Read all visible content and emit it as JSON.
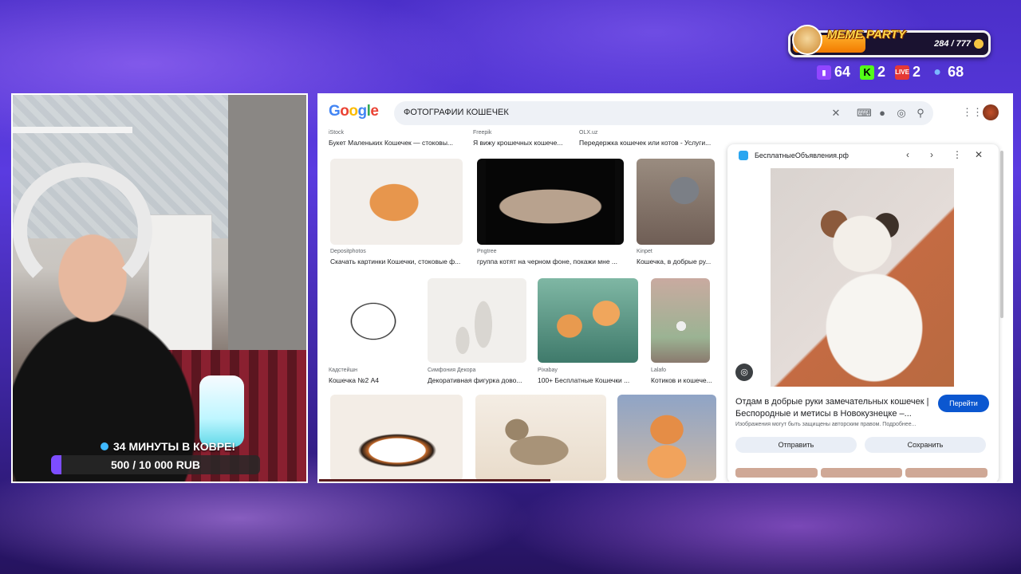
{
  "overlay": {
    "meme_party": {
      "title": "MEME PARTY",
      "count": "284 / 777",
      "progress": 0.3655
    },
    "stats": [
      {
        "icon": "twitch-icon",
        "value": "64"
      },
      {
        "icon": "kick-icon",
        "value": "2"
      },
      {
        "icon": "live-icon",
        "value": "2"
      },
      {
        "icon": "viewers-icon",
        "value": "68"
      }
    ]
  },
  "webcam": {
    "goal_top": "34 МИНУТЫ В КОВРЕ!",
    "goal_text": "500 / 10 000 RUB",
    "goal_progress": 0.05
  },
  "browser": {
    "search_query": "ФОТОГРАФИИ КОШЕЧЕК",
    "top_row": [
      {
        "source": "iStock",
        "caption": "Букет Маленьких Кошечек — стоковы..."
      },
      {
        "source": "Freepik",
        "caption": "Я вижу крошечных кошече..."
      },
      {
        "source": "OLX.uz",
        "caption": "Передержка кошечек или котов - Услуги..."
      }
    ],
    "row1": [
      {
        "source": "Depositphotos",
        "caption": "Скачать картинки Кошечки, стоковые ф..."
      },
      {
        "source": "Pngtree",
        "caption": "группа котят на черном фоне, покажи мне ..."
      },
      {
        "source": "Kinpet",
        "caption": "Кошечка, в добрые ру..."
      }
    ],
    "row2": [
      {
        "source": "Кадстейшн",
        "caption": "Кошечка №2 А4"
      },
      {
        "source": "Симфония Декора",
        "caption": "Декоративная фигурка дово..."
      },
      {
        "source": "Pixabay",
        "caption": "100+ Бесплатные Кошечки ..."
      },
      {
        "source": "Lalafo",
        "caption": "Котиков и кошече..."
      }
    ],
    "side_panel": {
      "site": "БесплатныеОбъявления.рф",
      "title": "Отдам в добрые руки замечательных кошечек | Беспородные и метисы в Новокузнецке –...",
      "go_label": "Перейти",
      "note": "Изображения могут быть защищены авторским правом. Подробнее...",
      "share_label": "Отправить",
      "save_label": "Сохранить"
    }
  }
}
